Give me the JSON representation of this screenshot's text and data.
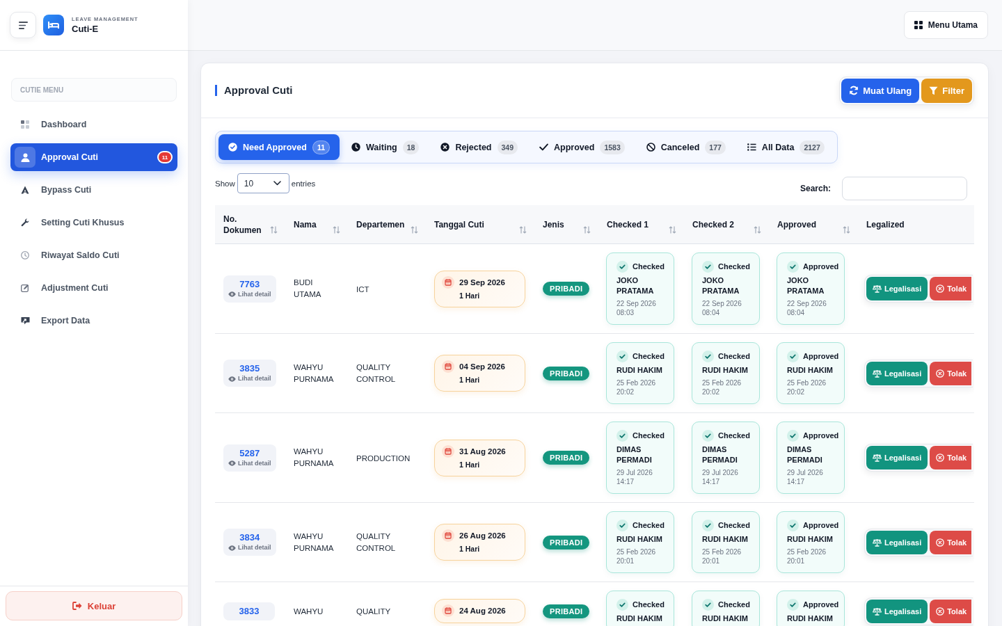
{
  "sidebar": {
    "app_subtitle": "LEAVE MANAGEMENT",
    "app_name": "Cuti-E",
    "section_label": "CUTIE MENU",
    "items": [
      {
        "label": "Dashboard",
        "selected": false
      },
      {
        "label": "Approval Cuti",
        "selected": true,
        "badge": "11"
      },
      {
        "label": "Bypass Cuti",
        "selected": false
      },
      {
        "label": "Setting Cuti Khusus",
        "selected": false
      },
      {
        "label": "Riwayat Saldo Cuti",
        "selected": false
      },
      {
        "label": "Adjustment Cuti",
        "selected": false
      },
      {
        "label": "Export Data",
        "selected": false
      }
    ],
    "logout_button": "Keluar"
  },
  "top_bar": {
    "menu_button": "Menu Utama"
  },
  "panel": {
    "title": "Approval Cuti",
    "buttons": [
      {
        "label": "Muat Ulang",
        "kind": "reload"
      },
      {
        "label": "Filter",
        "kind": "filter"
      }
    ]
  },
  "tabs": [
    {
      "label": "Need Approved",
      "count": "11",
      "selected": true
    },
    {
      "label": "Waiting",
      "count": "18",
      "selected": false
    },
    {
      "label": "Rejected",
      "count": "349",
      "selected": false
    },
    {
      "label": "Approved",
      "count": "1583",
      "selected": false
    },
    {
      "label": "Canceled",
      "count": "177",
      "selected": false
    },
    {
      "label": "All Data",
      "count": "2127",
      "selected": false
    }
  ],
  "table_controls": {
    "show_label": "Show",
    "page_size": "10",
    "entries_label": "entries",
    "search_label": "Search:"
  },
  "table": {
    "columns": [
      {
        "label": "No. Dokumen",
        "sortable": true
      },
      {
        "label": "Nama",
        "sortable": true
      },
      {
        "label": "Departemen",
        "sortable": true
      },
      {
        "label": "Tanggal Cuti",
        "sortable": true
      },
      {
        "label": "Jenis",
        "sortable": true
      },
      {
        "label": "Checked 1",
        "sortable": true
      },
      {
        "label": "Checked 2",
        "sortable": true
      },
      {
        "label": "Approved",
        "sortable": true
      },
      {
        "label": "Legalized",
        "sortable": false
      }
    ],
    "rows": [
      {
        "doc_no": "7763",
        "detail": "Lihat detail",
        "name": "BUDI UTAMA",
        "department": "ICT",
        "date": "29 Sep 2026",
        "duration": "1 Hari",
        "type": "PRIBADI",
        "approvals": [
          {
            "status": "Checked",
            "name": "JOKO PRATAMA",
            "time": "22 Sep 2026 08:03"
          },
          {
            "status": "Checked",
            "name": "JOKO PRATAMA",
            "time": "22 Sep 2026 08:04"
          },
          {
            "status": "Approved",
            "name": "JOKO PRATAMA",
            "time": "22 Sep 2026 08:04"
          }
        ],
        "actions": [
          {
            "label": "Legalisasi",
            "kind": "legalize"
          },
          {
            "label": "Tolak",
            "kind": "reject"
          }
        ]
      },
      {
        "doc_no": "3835",
        "detail": "Lihat detail",
        "name": "WAHYU PURNAMA",
        "department": "QUALITY CONTROL",
        "date": "04 Sep 2026",
        "duration": "1 Hari",
        "type": "PRIBADI",
        "approvals": [
          {
            "status": "Checked",
            "name": "RUDI HAKIM",
            "time": "25 Feb 2026 20:02"
          },
          {
            "status": "Checked",
            "name": "RUDI HAKIM",
            "time": "25 Feb 2026 20:02"
          },
          {
            "status": "Approved",
            "name": "RUDI HAKIM",
            "time": "25 Feb 2026 20:02"
          }
        ],
        "actions": [
          {
            "label": "Legalisasi",
            "kind": "legalize"
          },
          {
            "label": "Tolak",
            "kind": "reject"
          }
        ]
      },
      {
        "doc_no": "5287",
        "detail": "Lihat detail",
        "name": "WAHYU PURNAMA",
        "department": "PRODUCTION",
        "date": "31 Aug 2026",
        "duration": "1 Hari",
        "type": "PRIBADI",
        "approvals": [
          {
            "status": "Checked",
            "name": "DIMAS PERMADI",
            "time": "29 Jul 2026 14:17"
          },
          {
            "status": "Checked",
            "name": "DIMAS PERMADI",
            "time": "29 Jul 2026 14:17"
          },
          {
            "status": "Approved",
            "name": "DIMAS PERMADI",
            "time": "29 Jul 2026 14:17"
          }
        ],
        "actions": [
          {
            "label": "Legalisasi",
            "kind": "legalize"
          },
          {
            "label": "Tolak",
            "kind": "reject"
          }
        ]
      },
      {
        "doc_no": "3834",
        "detail": "Lihat detail",
        "name": "WAHYU PURNAMA",
        "department": "QUALITY CONTROL",
        "date": "26 Aug 2026",
        "duration": "1 Hari",
        "type": "PRIBADI",
        "approvals": [
          {
            "status": "Checked",
            "name": "RUDI HAKIM",
            "time": "25 Feb 2026 20:01"
          },
          {
            "status": "Checked",
            "name": "RUDI HAKIM",
            "time": "25 Feb 2026 20:01"
          },
          {
            "status": "Approved",
            "name": "RUDI HAKIM",
            "time": "25 Feb 2026 20:01"
          }
        ],
        "actions": [
          {
            "label": "Legalisasi",
            "kind": "legalize"
          },
          {
            "label": "Tolak",
            "kind": "reject"
          }
        ]
      },
      {
        "doc_no": "3833",
        "name": "WAHYU",
        "department": "QUALITY",
        "date": "24 Aug 2026",
        "type": "PRIBADI",
        "approvals": [
          {
            "status": "Checked",
            "name": "RUDI HAKIM"
          },
          {
            "status": "Checked",
            "name": "RUDI HAKIM"
          },
          {
            "status": "Approved",
            "name": "RUDI HAKIM"
          }
        ],
        "actions": [
          {
            "label": "Legalisasi",
            "kind": "legalize"
          },
          {
            "label": "Tolak",
            "kind": "reject"
          }
        ]
      }
    ]
  }
}
